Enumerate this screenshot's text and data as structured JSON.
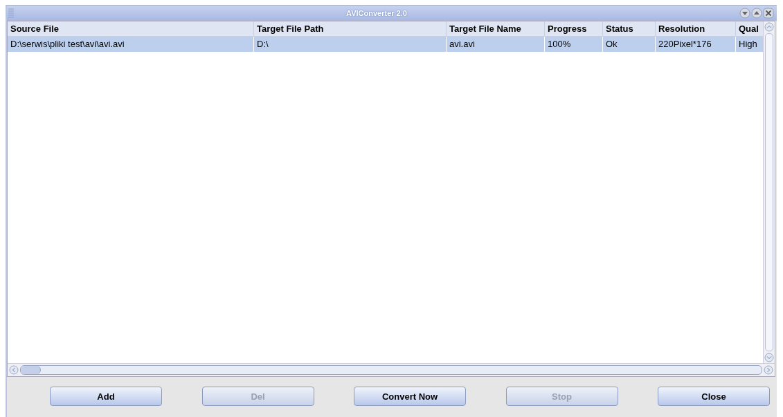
{
  "window": {
    "title": "AVIConverter 2.0"
  },
  "table": {
    "columns": [
      "Source File",
      "Target File Path",
      "Target File Name",
      "Progress",
      "Status",
      "Resolution",
      "Qual"
    ],
    "rows": [
      {
        "selected": true,
        "cells": [
          "D:\\serwis\\pliki test\\avi\\avi.avi",
          "D:\\",
          "avi.avi",
          "100%",
          "Ok",
          "220Pixel*176",
          "High"
        ]
      }
    ]
  },
  "buttons": [
    {
      "label": "Add",
      "disabled": false
    },
    {
      "label": "Del",
      "disabled": true
    },
    {
      "label": "Convert Now",
      "disabled": false
    },
    {
      "label": "Stop",
      "disabled": true
    },
    {
      "label": "Close",
      "disabled": false
    }
  ]
}
